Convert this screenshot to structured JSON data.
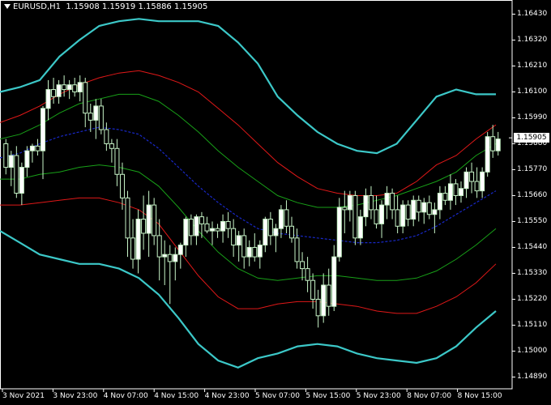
{
  "header": {
    "symbol_label": "EURUSD,H1",
    "ohlc": "1.15908 1.15919 1.15886 1.15905"
  },
  "price_axis": {
    "ticks": [
      "1.16430",
      "1.16320",
      "1.16210",
      "1.16100",
      "1.15990",
      "1.15880",
      "1.15770",
      "1.15660",
      "1.15550",
      "1.15440",
      "1.15330",
      "1.15220",
      "1.15110",
      "1.15000",
      "1.14890"
    ],
    "current_price": "1.15905"
  },
  "time_axis": {
    "ticks": [
      "3 Nov 2021",
      "3 Nov 23:00",
      "4 Nov 07:00",
      "4 Nov 15:00",
      "4 Nov 23:00",
      "5 Nov 07:00",
      "5 Nov 15:00",
      "5 Nov 23:00",
      "8 Nov 07:00",
      "8 Nov 15:00"
    ]
  },
  "colors": {
    "background": "#000000",
    "bull_candle": "#ffffff",
    "bear_candle": "#000000",
    "candle_body_outline": "#c8f5c8",
    "candle_wick": "#c8f5c8",
    "band_outer": "#3cc8c8",
    "band_middle": "#e01818",
    "band_inner": "#18a018",
    "center_line": "#1828c8",
    "axis": "#ffffff"
  },
  "chart_data": {
    "type": "candlestick",
    "symbol": "EURUSD",
    "timeframe": "H1",
    "ylim": [
      1.1484,
      1.1649
    ],
    "candles_ohlc": [
      [
        1.1588,
        1.159,
        1.1575,
        1.1578
      ],
      [
        1.1578,
        1.1585,
        1.157,
        1.1583
      ],
      [
        1.1583,
        1.1587,
        1.1565,
        1.1567
      ],
      [
        1.1567,
        1.158,
        1.1562,
        1.1578
      ],
      [
        1.1578,
        1.1587,
        1.1574,
        1.1585
      ],
      [
        1.1585,
        1.1588,
        1.158,
        1.1587
      ],
      [
        1.1587,
        1.159,
        1.1583,
        1.1585
      ],
      [
        1.1585,
        1.1604,
        1.1573,
        1.1603
      ],
      [
        1.1603,
        1.1615,
        1.1598,
        1.1611
      ],
      [
        1.1611,
        1.1616,
        1.1605,
        1.1608
      ],
      [
        1.1608,
        1.1615,
        1.1605,
        1.1613
      ],
      [
        1.1613,
        1.1617,
        1.1608,
        1.1611
      ],
      [
        1.1611,
        1.1615,
        1.1607,
        1.1613
      ],
      [
        1.1613,
        1.1616,
        1.1608,
        1.161
      ],
      [
        1.161,
        1.1617,
        1.1606,
        1.1614
      ],
      [
        1.1614,
        1.1616,
        1.1595,
        1.1601
      ],
      [
        1.1601,
        1.1605,
        1.1593,
        1.1598
      ],
      [
        1.1598,
        1.1607,
        1.159,
        1.1604
      ],
      [
        1.1604,
        1.1607,
        1.1592,
        1.1594
      ],
      [
        1.1594,
        1.1597,
        1.1585,
        1.1588
      ],
      [
        1.1588,
        1.159,
        1.158,
        1.1586
      ],
      [
        1.1586,
        1.159,
        1.157,
        1.1575
      ],
      [
        1.1575,
        1.158,
        1.156,
        1.1565
      ],
      [
        1.1565,
        1.1568,
        1.154,
        1.1548
      ],
      [
        1.1548,
        1.1556,
        1.1535,
        1.1539
      ],
      [
        1.1539,
        1.156,
        1.1533,
        1.1556
      ],
      [
        1.1556,
        1.1566,
        1.1543,
        1.155
      ],
      [
        1.155,
        1.1568,
        1.154,
        1.1562
      ],
      [
        1.1562,
        1.1565,
        1.1545,
        1.1549
      ],
      [
        1.1549,
        1.1556,
        1.153,
        1.154
      ],
      [
        1.154,
        1.1547,
        1.1528,
        1.1541
      ],
      [
        1.1541,
        1.1545,
        1.152,
        1.1538
      ],
      [
        1.1538,
        1.1544,
        1.153,
        1.1541
      ],
      [
        1.1541,
        1.1546,
        1.1535,
        1.1545
      ],
      [
        1.1545,
        1.1557,
        1.154,
        1.1556
      ],
      [
        1.1556,
        1.1558,
        1.1545,
        1.1549
      ],
      [
        1.1549,
        1.1558,
        1.1545,
        1.1557
      ],
      [
        1.1557,
        1.1559,
        1.1548,
        1.1554
      ],
      [
        1.1554,
        1.1557,
        1.155,
        1.1551
      ],
      [
        1.1551,
        1.1555,
        1.1545,
        1.1552
      ],
      [
        1.1552,
        1.1554,
        1.1548,
        1.1551
      ],
      [
        1.1551,
        1.1558,
        1.1546,
        1.1555
      ],
      [
        1.1555,
        1.1559,
        1.1548,
        1.1552
      ],
      [
        1.1552,
        1.1556,
        1.154,
        1.1545
      ],
      [
        1.1545,
        1.1551,
        1.1538,
        1.1549
      ],
      [
        1.1549,
        1.1552,
        1.1535,
        1.154
      ],
      [
        1.154,
        1.1547,
        1.1536,
        1.1544
      ],
      [
        1.1544,
        1.155,
        1.1538,
        1.154
      ],
      [
        1.154,
        1.1547,
        1.1535,
        1.1545
      ],
      [
        1.1545,
        1.1557,
        1.1542,
        1.1556
      ],
      [
        1.1556,
        1.1559,
        1.1545,
        1.1549
      ],
      [
        1.1549,
        1.1554,
        1.1542,
        1.1552
      ],
      [
        1.1552,
        1.1562,
        1.1548,
        1.156
      ],
      [
        1.156,
        1.1564,
        1.155,
        1.1553
      ],
      [
        1.1553,
        1.1557,
        1.1546,
        1.1548
      ],
      [
        1.1548,
        1.1552,
        1.1535,
        1.1538
      ],
      [
        1.1538,
        1.1542,
        1.153,
        1.1535
      ],
      [
        1.1535,
        1.154,
        1.1525,
        1.153
      ],
      [
        1.153,
        1.1533,
        1.1518,
        1.1522
      ],
      [
        1.1522,
        1.1526,
        1.151,
        1.1515
      ],
      [
        1.1515,
        1.1533,
        1.1512,
        1.1528
      ],
      [
        1.1528,
        1.1535,
        1.1515,
        1.1519
      ],
      [
        1.1519,
        1.1545,
        1.1517,
        1.154
      ],
      [
        1.154,
        1.1565,
        1.1538,
        1.1561
      ],
      [
        1.1561,
        1.1568,
        1.155,
        1.156
      ],
      [
        1.156,
        1.1568,
        1.1555,
        1.1566
      ],
      [
        1.1566,
        1.1568,
        1.1545,
        1.1548
      ],
      [
        1.1548,
        1.156,
        1.1545,
        1.1557
      ],
      [
        1.1557,
        1.1569,
        1.1553,
        1.1566
      ],
      [
        1.1566,
        1.157,
        1.1556,
        1.156
      ],
      [
        1.156,
        1.1566,
        1.1552,
        1.1554
      ],
      [
        1.1554,
        1.1564,
        1.1548,
        1.1562
      ],
      [
        1.1562,
        1.157,
        1.1556,
        1.1567
      ],
      [
        1.1567,
        1.1569,
        1.1556,
        1.156
      ],
      [
        1.156,
        1.1566,
        1.155,
        1.1553
      ],
      [
        1.1553,
        1.1564,
        1.155,
        1.1562
      ],
      [
        1.1562,
        1.1564,
        1.1553,
        1.1556
      ],
      [
        1.1556,
        1.1566,
        1.1553,
        1.1564
      ],
      [
        1.1564,
        1.1566,
        1.1555,
        1.1559
      ],
      [
        1.1559,
        1.1565,
        1.1554,
        1.1563
      ],
      [
        1.1563,
        1.1566,
        1.1556,
        1.1558
      ],
      [
        1.1558,
        1.1563,
        1.155,
        1.156
      ],
      [
        1.156,
        1.157,
        1.1556,
        1.1567
      ],
      [
        1.1567,
        1.157,
        1.1562,
        1.1564
      ],
      [
        1.1564,
        1.1575,
        1.156,
        1.1571
      ],
      [
        1.1571,
        1.1573,
        1.1562,
        1.1566
      ],
      [
        1.1566,
        1.1572,
        1.1563,
        1.1569
      ],
      [
        1.1569,
        1.1578,
        1.1565,
        1.1576
      ],
      [
        1.1576,
        1.158,
        1.1567,
        1.1572
      ],
      [
        1.1572,
        1.1578,
        1.1565,
        1.1568
      ],
      [
        1.1568,
        1.1578,
        1.1565,
        1.1576
      ],
      [
        1.1576,
        1.1593,
        1.1574,
        1.1591
      ],
      [
        1.1591,
        1.1596,
        1.1582,
        1.1585
      ],
      [
        1.1585,
        1.1593,
        1.1583,
        1.159
      ]
    ],
    "bands": {
      "outer_upper": [
        1.161,
        1.1612,
        1.1615,
        1.1625,
        1.1632,
        1.1638,
        1.164,
        1.1641,
        1.164,
        1.164,
        1.164,
        1.1638,
        1.1631,
        1.1622,
        1.1608,
        1.16,
        1.1593,
        1.1588,
        1.1585,
        1.1584,
        1.1588,
        1.1598,
        1.1608,
        1.1611,
        1.1609,
        1.1609
      ],
      "middle_upper": [
        1.1597,
        1.16,
        1.1604,
        1.1609,
        1.1613,
        1.1616,
        1.1618,
        1.1619,
        1.1617,
        1.1614,
        1.161,
        1.1603,
        1.1596,
        1.1588,
        1.158,
        1.1574,
        1.1569,
        1.1567,
        1.1566,
        1.1566,
        1.1567,
        1.1572,
        1.1579,
        1.1583,
        1.159,
        1.1596
      ],
      "inner_upper": [
        1.159,
        1.1592,
        1.1596,
        1.1601,
        1.1605,
        1.1607,
        1.1609,
        1.1609,
        1.1606,
        1.16,
        1.1593,
        1.1585,
        1.1578,
        1.1572,
        1.1566,
        1.1563,
        1.1561,
        1.1561,
        1.1562,
        1.1564,
        1.1566,
        1.1569,
        1.1572,
        1.1576,
        1.1583,
        1.1588
      ],
      "center": [
        1.1582,
        1.1584,
        1.1588,
        1.1591,
        1.1593,
        1.1595,
        1.1594,
        1.1592,
        1.1586,
        1.1578,
        1.157,
        1.1563,
        1.1557,
        1.1552,
        1.155,
        1.1549,
        1.1548,
        1.1547,
        1.1546,
        1.1546,
        1.1547,
        1.1549,
        1.1553,
        1.1558,
        1.1563,
        1.1568
      ],
      "inner_lower": [
        1.1573,
        1.1573,
        1.1575,
        1.1576,
        1.1578,
        1.1579,
        1.1578,
        1.1576,
        1.157,
        1.1561,
        1.1551,
        1.1542,
        1.1535,
        1.1531,
        1.153,
        1.1531,
        1.1532,
        1.1532,
        1.1531,
        1.153,
        1.153,
        1.1531,
        1.1534,
        1.1539,
        1.1545,
        1.1552
      ],
      "middle_lower": [
        1.1562,
        1.1562,
        1.1563,
        1.1564,
        1.1565,
        1.1565,
        1.1563,
        1.156,
        1.1554,
        1.1543,
        1.1532,
        1.1523,
        1.1518,
        1.1518,
        1.152,
        1.1521,
        1.1521,
        1.152,
        1.1519,
        1.1517,
        1.1516,
        1.1516,
        1.1519,
        1.1523,
        1.1529,
        1.1537
      ],
      "outer_lower": [
        1.1551,
        1.1546,
        1.1541,
        1.1539,
        1.1537,
        1.1537,
        1.1535,
        1.1531,
        1.1524,
        1.1514,
        1.1503,
        1.1496,
        1.1493,
        1.1497,
        1.1499,
        1.1502,
        1.1503,
        1.1502,
        1.1499,
        1.1497,
        1.1496,
        1.1495,
        1.1497,
        1.1502,
        1.151,
        1.1517
      ]
    }
  }
}
